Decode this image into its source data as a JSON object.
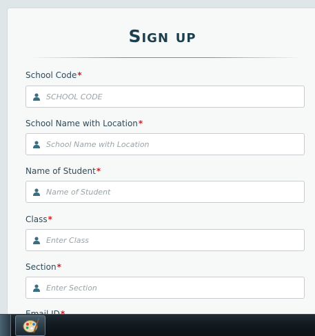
{
  "form": {
    "title": "Sign up",
    "fields": [
      {
        "label": "School Code",
        "required_mark": "*",
        "placeholder": "SCHOOL CODE",
        "value": ""
      },
      {
        "label": "School Name with Location",
        "required_mark": "*",
        "placeholder": "School Name with Location",
        "value": ""
      },
      {
        "label": "Name of Student",
        "required_mark": "*",
        "placeholder": "Name of Student",
        "value": ""
      },
      {
        "label": "Class",
        "required_mark": "*",
        "placeholder": "Enter Class",
        "value": ""
      },
      {
        "label": "Section",
        "required_mark": "*",
        "placeholder": "Enter Section",
        "value": ""
      },
      {
        "label": "Email ID",
        "required_mark": "*"
      }
    ],
    "colors": {
      "title": "#1c3f4f",
      "label": "#2f4a58",
      "required": "#d91a1a",
      "placeholder": "#9aa3a8",
      "field_icon": "#3a6f82"
    }
  },
  "taskbar": {
    "pinned_app_icon": "paint-palette-icon"
  }
}
